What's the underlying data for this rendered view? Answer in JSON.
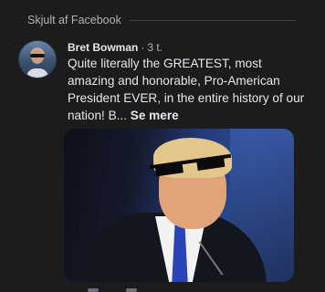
{
  "hidden_notice": {
    "label": "Skjult af Facebook"
  },
  "post": {
    "author": "Bret Bowman",
    "separator": "·",
    "time": "3 t.",
    "text": "Quite literally the GREATEST, most amazing and honorable, Pro-American President EVER, in the entire history of our nation! B...",
    "see_more_label": "Se mere"
  },
  "icons": {
    "top_row": [
      "reaction-icon",
      "share-icon"
    ],
    "bottom_row": [
      "like-icon",
      "comment-icon"
    ]
  }
}
